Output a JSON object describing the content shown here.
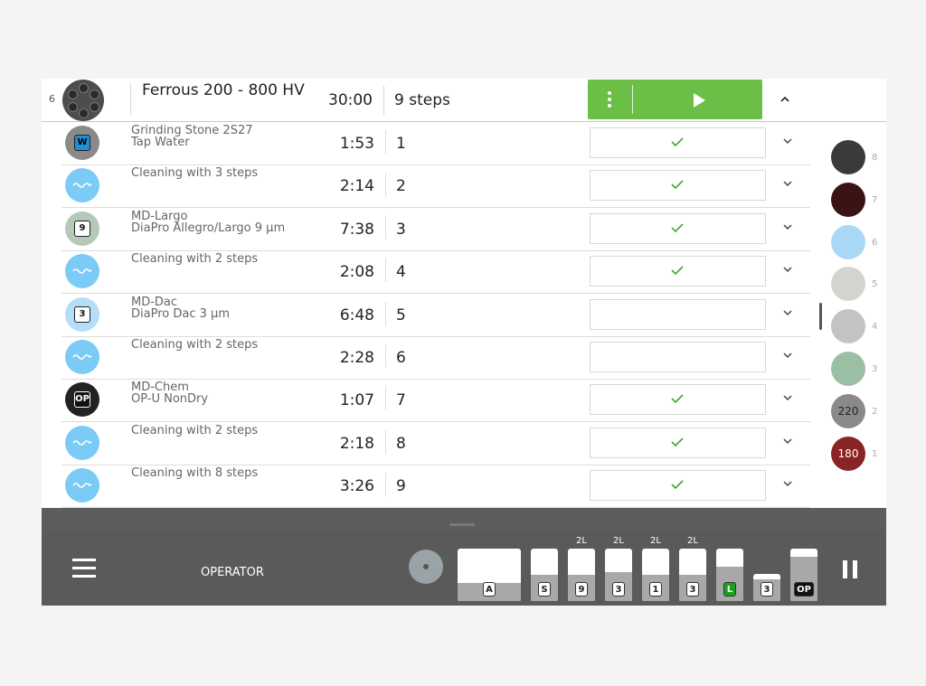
{
  "header": {
    "index": "6",
    "title": "Ferrous 200 - 800 HV",
    "time": "30:00",
    "steps": "9 steps",
    "run_color": "#6bbf47"
  },
  "rows": [
    {
      "icon": "grinding-stone-disc",
      "badge": "W",
      "line1": "Grinding Stone 2S27",
      "line2": "Tap Water",
      "time": "1:53",
      "step": "1",
      "checked": true
    },
    {
      "icon": "cleaning-disc",
      "badge": "",
      "line1": "Cleaning with 3 steps",
      "line2": "",
      "time": "2:14",
      "step": "2",
      "checked": true
    },
    {
      "icon": "md-largo-disc",
      "badge": "9",
      "line1": "MD-Largo",
      "line2": "DiaPro Allegro/Largo 9 µm",
      "time": "7:38",
      "step": "3",
      "checked": true
    },
    {
      "icon": "cleaning-disc",
      "badge": "",
      "line1": "Cleaning with 2 steps",
      "line2": "",
      "time": "2:08",
      "step": "4",
      "checked": true
    },
    {
      "icon": "md-dac-disc",
      "badge": "3",
      "line1": "MD-Dac",
      "line2": "DiaPro Dac 3 µm",
      "time": "6:48",
      "step": "5",
      "checked": false
    },
    {
      "icon": "cleaning-disc",
      "badge": "",
      "line1": "Cleaning with 2 steps",
      "line2": "",
      "time": "2:28",
      "step": "6",
      "checked": false
    },
    {
      "icon": "md-chem-disc",
      "badge": "OP",
      "line1": "MD-Chem",
      "line2": "OP-U NonDry",
      "time": "1:07",
      "step": "7",
      "checked": true
    },
    {
      "icon": "cleaning-disc",
      "badge": "",
      "line1": "Cleaning with 2 steps",
      "line2": "",
      "time": "2:18",
      "step": "8",
      "checked": true
    },
    {
      "icon": "cleaning-disc",
      "badge": "",
      "line1": "Cleaning with 8 steps",
      "line2": "",
      "time": "3:26",
      "step": "9",
      "checked": true
    }
  ],
  "side_discs": [
    {
      "slot": "8",
      "label": "",
      "color": "#3a3a3a"
    },
    {
      "slot": "7",
      "label": "",
      "color": "#3a1414"
    },
    {
      "slot": "6",
      "label": "",
      "color": "#a9d8f7"
    },
    {
      "slot": "5",
      "label": "",
      "color": "#d4d4cf"
    },
    {
      "slot": "4",
      "label": "",
      "color": "#c3c3c3"
    },
    {
      "slot": "3",
      "label": "",
      "color": "#9bbfa5"
    },
    {
      "slot": "2",
      "label": "220",
      "color": "#8a8a8a"
    },
    {
      "slot": "1",
      "label": "180",
      "color": "#8a2424"
    }
  ],
  "bottom": {
    "role": "OPERATOR",
    "containers": [
      {
        "label": "A",
        "cap": "",
        "level": 0.35
      },
      {
        "label": "S",
        "cap": "",
        "level": 0.5
      },
      {
        "label": "9",
        "cap": "2L",
        "level": 0.5
      },
      {
        "label": "3",
        "cap": "2L",
        "level": 0.55
      },
      {
        "label": "1",
        "cap": "2L",
        "level": 0.5
      },
      {
        "label": "3",
        "cap": "2L",
        "level": 0.5
      },
      {
        "label": "L",
        "cap": "",
        "level": 0.65
      },
      {
        "label": "3",
        "cap": "",
        "level": 0.8
      },
      {
        "label": "OP",
        "cap": "",
        "level": 0.85
      }
    ]
  }
}
